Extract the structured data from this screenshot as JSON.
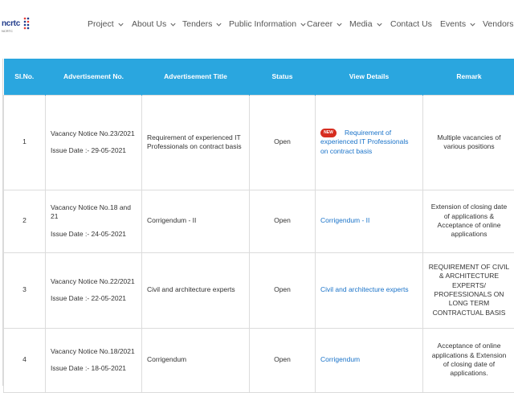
{
  "header": {
    "logo_text": "ncrtc",
    "logo_sub": "NCRTC",
    "nav": [
      {
        "label": "Project",
        "has_dropdown": true
      },
      {
        "label": "About Us",
        "has_dropdown": true
      },
      {
        "label": "Tenders",
        "has_dropdown": true
      },
      {
        "label": "Public Information",
        "has_dropdown": true
      },
      {
        "label": "Career",
        "has_dropdown": true
      },
      {
        "label": "Media",
        "has_dropdown": true
      },
      {
        "label": "Contact Us",
        "has_dropdown": false
      },
      {
        "label": "Events",
        "has_dropdown": true
      },
      {
        "label": "Vendors",
        "has_dropdown": false
      }
    ]
  },
  "table": {
    "header_color": "#2aa6df",
    "columns": [
      "Sl.No.",
      "Advertisement No.",
      "Advertisement Title",
      "Status",
      "View Details",
      "Remark"
    ],
    "rows": [
      {
        "sl": "1",
        "notice": "Vacancy Notice No.23/2021",
        "issue_date": "Issue Date :- 29-05-2021",
        "title": "Requirement of experienced IT Professionals on contract basis",
        "status": "Open",
        "new_badge": "NEW",
        "details": "Requirement of experienced IT Professionals on contract basis",
        "remark": "Multiple vacancies of various positions"
      },
      {
        "sl": "2",
        "notice": "Vacancy Notice No.18 and 21",
        "issue_date": "Issue Date :- 24-05-2021",
        "title": "Corrigendum - II",
        "status": "Open",
        "details": "Corrigendum - II",
        "remark": "Extension of closing date of applications & Acceptance of online applications"
      },
      {
        "sl": "3",
        "notice": "Vacancy Notice No.22/2021",
        "issue_date": "Issue Date :- 22-05-2021",
        "title": "Civil and architecture experts",
        "status": "Open",
        "details": "Civil and architecture experts",
        "remark": "REQUIREMENT OF CIVIL & ARCHITECTURE EXPERTS/ PROFESSIONALS ON LONG TERM CONTRACTUAL BASIS"
      },
      {
        "sl": "4",
        "notice": "Vacancy Notice No.18/2021",
        "issue_date": "Issue Date :- 18-05-2021",
        "title": "Corrigendum",
        "status": "Open",
        "details": "Corrigendum",
        "remark": "Acceptance of online applications & Extension of closing date of applications."
      }
    ]
  }
}
